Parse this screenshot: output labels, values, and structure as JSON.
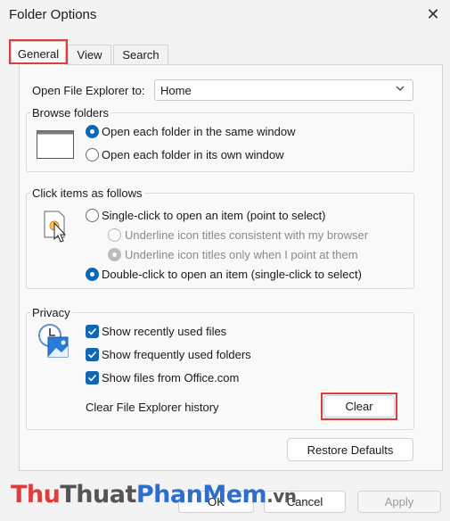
{
  "window": {
    "title": "Folder Options",
    "close_glyph": "✕"
  },
  "tabs": [
    {
      "label": "General",
      "active": true
    },
    {
      "label": "View",
      "active": false
    },
    {
      "label": "Search",
      "active": false
    }
  ],
  "open_explorer": {
    "label": "Open File Explorer to:",
    "value": "Home"
  },
  "browse": {
    "title": "Browse folders",
    "options": [
      {
        "label": "Open each folder in the same window",
        "selected": true
      },
      {
        "label": "Open each folder in its own window",
        "selected": false
      }
    ]
  },
  "click_items": {
    "title": "Click items as follows",
    "single": "Single-click to open an item (point to select)",
    "underline_consistent": "Underline icon titles consistent with my browser",
    "underline_point": "Underline icon titles only when I point at them",
    "double": "Double-click to open an item (single-click to select)"
  },
  "privacy": {
    "title": "Privacy",
    "checks": [
      {
        "label": "Show recently used files",
        "checked": true
      },
      {
        "label": "Show frequently used folders",
        "checked": true
      },
      {
        "label": "Show files from Office.com",
        "checked": true
      }
    ],
    "clear_label": "Clear File Explorer history",
    "clear_button": "Clear"
  },
  "restore_button": "Restore Defaults",
  "footer": {
    "ok": "OK",
    "cancel": "Cancel",
    "apply": "Apply"
  },
  "watermark": {
    "part1": "Thu",
    "part2": "Thuat",
    "part3": "PhanMem",
    "part4": ".vn"
  },
  "colors": {
    "accent": "#1067b3",
    "highlight": "#e03c3c"
  }
}
